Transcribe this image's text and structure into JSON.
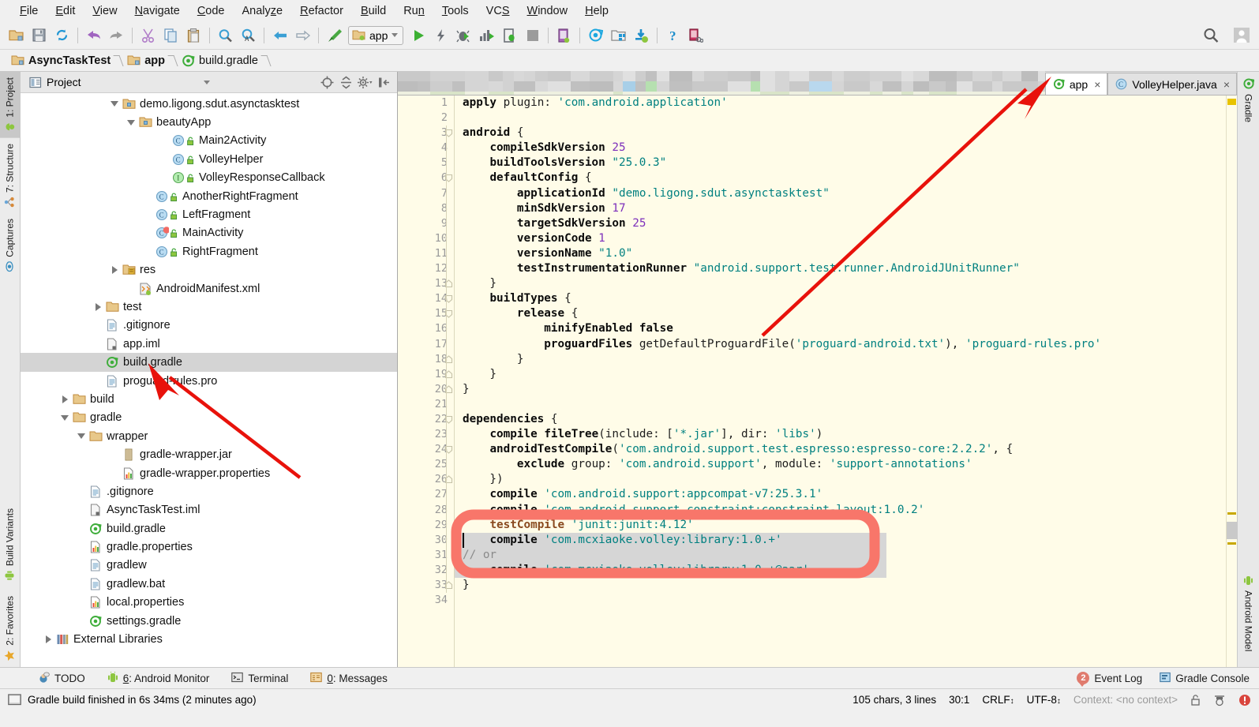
{
  "window": {
    "menus": [
      {
        "label": "File",
        "mnemonic": "F"
      },
      {
        "label": "Edit",
        "mnemonic": "E"
      },
      {
        "label": "View",
        "mnemonic": "V"
      },
      {
        "label": "Navigate",
        "mnemonic": "N"
      },
      {
        "label": "Code",
        "mnemonic": "C"
      },
      {
        "label": "Analyze",
        "mnemonic": "z"
      },
      {
        "label": "Refactor",
        "mnemonic": "R"
      },
      {
        "label": "Build",
        "mnemonic": "B"
      },
      {
        "label": "Run",
        "mnemonic": "n"
      },
      {
        "label": "Tools",
        "mnemonic": "T"
      },
      {
        "label": "VCS",
        "mnemonic": "S"
      },
      {
        "label": "Window",
        "mnemonic": "W"
      },
      {
        "label": "Help",
        "mnemonic": "H"
      }
    ]
  },
  "toolbar": {
    "icons": [
      "open-folder-icon",
      "save-all-icon",
      "sync-icon",
      "undo-icon",
      "redo-icon",
      "cut-icon",
      "copy-icon",
      "paste-icon",
      "find-icon",
      "replace-icon",
      "back-icon",
      "forward-icon",
      "make-project-icon"
    ],
    "run_config": "app",
    "run_icons": [
      "run-icon",
      "apply-changes-icon",
      "debug-icon",
      "run-with-coverage-icon",
      "attach-debugger-icon",
      "stop-icon",
      "avd-manager-icon",
      "sync-gradle-icon",
      "sdk-manager-icon",
      "download-icon",
      "help-icon",
      "device-monitor-icon"
    ],
    "search_icon": "search-everywhere-icon",
    "account_icon": "user-account-icon"
  },
  "breadcrumb": [
    {
      "label": "AsyncTaskTest",
      "icon": "module-folder-icon"
    },
    {
      "label": "app",
      "icon": "module-folder-icon"
    },
    {
      "label": "build.gradle",
      "icon": "gradle-file-icon"
    }
  ],
  "left_tool_buttons": [
    {
      "label": "1: Project",
      "icon": "android-icon",
      "active": true
    },
    {
      "label": "7: Structure",
      "icon": "structure-icon",
      "active": false
    },
    {
      "label": "Captures",
      "icon": "captures-icon",
      "active": false
    },
    {
      "label": "Build Variants",
      "icon": "android-green-icon",
      "active": false
    },
    {
      "label": "2: Favorites",
      "icon": "star-icon",
      "active": false
    }
  ],
  "right_tool_buttons": [
    {
      "label": "Gradle",
      "icon": "gradle-icon"
    },
    {
      "label": "Android Model",
      "icon": "android-green-icon"
    }
  ],
  "project_panel": {
    "title": "Project",
    "title_icon": "project-view-icon",
    "tools": [
      "locate-icon",
      "collapse-all-icon",
      "settings-gear-icon",
      "hide-icon"
    ],
    "tree": [
      {
        "label": "demo.ligong.sdut.asynctasktest",
        "indent": 5,
        "arrow": "open",
        "icon": "package-folder-icon",
        "selected": false
      },
      {
        "label": "beautyApp",
        "indent": 6,
        "arrow": "open",
        "icon": "package-folder-icon",
        "selected": false
      },
      {
        "label": "Main2Activity",
        "indent": 8,
        "arrow": "none",
        "icon": "class-icon",
        "selected": false
      },
      {
        "label": "VolleyHelper",
        "indent": 8,
        "arrow": "none",
        "icon": "class-icon",
        "selected": false
      },
      {
        "label": "VolleyResponseCallback",
        "indent": 8,
        "arrow": "none",
        "icon": "interface-icon",
        "selected": false
      },
      {
        "label": "AnotherRightFragment",
        "indent": 7,
        "arrow": "none",
        "icon": "class-icon",
        "selected": false
      },
      {
        "label": "LeftFragment",
        "indent": 7,
        "arrow": "none",
        "icon": "class-icon",
        "selected": false
      },
      {
        "label": "MainActivity",
        "indent": 7,
        "arrow": "none",
        "icon": "class-run-icon",
        "selected": false
      },
      {
        "label": "RightFragment",
        "indent": 7,
        "arrow": "none",
        "icon": "class-icon",
        "selected": false
      },
      {
        "label": "res",
        "indent": 5,
        "arrow": "closed",
        "icon": "res-folder-icon",
        "selected": false
      },
      {
        "label": "AndroidManifest.xml",
        "indent": 6,
        "arrow": "none",
        "icon": "manifest-icon",
        "selected": false
      },
      {
        "label": "test",
        "indent": 4,
        "arrow": "closed",
        "icon": "folder-icon",
        "selected": false
      },
      {
        "label": ".gitignore",
        "indent": 4,
        "arrow": "none",
        "icon": "text-file-icon",
        "selected": false
      },
      {
        "label": "app.iml",
        "indent": 4,
        "arrow": "none",
        "icon": "iml-file-icon",
        "selected": false
      },
      {
        "label": "build.gradle",
        "indent": 4,
        "arrow": "none",
        "icon": "gradle-file-icon",
        "selected": true
      },
      {
        "label": "proguard-rules.pro",
        "indent": 4,
        "arrow": "none",
        "icon": "text-file-icon",
        "selected": false
      },
      {
        "label": "build",
        "indent": 2,
        "arrow": "closed",
        "icon": "folder-icon",
        "selected": false
      },
      {
        "label": "gradle",
        "indent": 2,
        "arrow": "open",
        "icon": "folder-icon",
        "selected": false
      },
      {
        "label": "wrapper",
        "indent": 3,
        "arrow": "open",
        "icon": "folder-icon",
        "selected": false
      },
      {
        "label": "gradle-wrapper.jar",
        "indent": 5,
        "arrow": "none",
        "icon": "jar-file-icon",
        "selected": false
      },
      {
        "label": "gradle-wrapper.properties",
        "indent": 5,
        "arrow": "none",
        "icon": "properties-file-icon",
        "selected": false
      },
      {
        "label": ".gitignore",
        "indent": 3,
        "arrow": "none",
        "icon": "text-file-icon",
        "selected": false
      },
      {
        "label": "AsyncTaskTest.iml",
        "indent": 3,
        "arrow": "none",
        "icon": "iml-file-icon",
        "selected": false
      },
      {
        "label": "build.gradle",
        "indent": 3,
        "arrow": "none",
        "icon": "gradle-file-icon",
        "selected": false
      },
      {
        "label": "gradle.properties",
        "indent": 3,
        "arrow": "none",
        "icon": "properties-file-icon",
        "selected": false
      },
      {
        "label": "gradlew",
        "indent": 3,
        "arrow": "none",
        "icon": "text-file-icon",
        "selected": false
      },
      {
        "label": "gradlew.bat",
        "indent": 3,
        "arrow": "none",
        "icon": "text-file-icon",
        "selected": false
      },
      {
        "label": "local.properties",
        "indent": 3,
        "arrow": "none",
        "icon": "properties-file-icon",
        "selected": false
      },
      {
        "label": "settings.gradle",
        "indent": 3,
        "arrow": "none",
        "icon": "gradle-file-icon",
        "selected": false
      },
      {
        "label": "External Libraries",
        "indent": 1,
        "arrow": "closed",
        "icon": "libraries-icon",
        "selected": false
      }
    ]
  },
  "editor": {
    "tabs": [
      {
        "label": "app",
        "icon": "gradle-file-icon",
        "active": true,
        "close": "×"
      },
      {
        "label": "VolleyHelper.java",
        "icon": "class-icon",
        "active": false,
        "close": "×"
      }
    ],
    "first_line": 1,
    "last_line": 34,
    "highlighted_lines": [
      30,
      31,
      32
    ],
    "code_lines": [
      "apply plugin: 'com.android.application'",
      "",
      "android {",
      "    compileSdkVersion 25",
      "    buildToolsVersion \"25.0.3\"",
      "    defaultConfig {",
      "        applicationId \"demo.ligong.sdut.asynctasktest\"",
      "        minSdkVersion 17",
      "        targetSdkVersion 25",
      "        versionCode 1",
      "        versionName \"1.0\"",
      "        testInstrumentationRunner \"android.support.test.runner.AndroidJUnitRunner\"",
      "    }",
      "    buildTypes {",
      "        release {",
      "            minifyEnabled false",
      "            proguardFiles getDefaultProguardFile('proguard-android.txt'), 'proguard-rules.pro'",
      "        }",
      "    }",
      "}",
      "",
      "dependencies {",
      "    compile fileTree(include: ['*.jar'], dir: 'libs')",
      "    androidTestCompile('com.android.support.test.espresso:espresso-core:2.2.2', {",
      "        exclude group: 'com.android.support', module: 'support-annotations'",
      "    })",
      "    compile 'com.android.support:appcompat-v7:25.3.1'",
      "    compile 'com.android.support.constraint:constraint-layout:1.0.2'",
      "    testCompile 'junit:junit:4.12'",
      "    compile 'com.mcxiaoke.volley:library:1.0.+'",
      "// or",
      "    compile 'com.mcxiaoke.volley:library:1.0.+@aar'",
      "}",
      ""
    ]
  },
  "bottom_tool_buttons": [
    {
      "label": "TODO",
      "icon": "todo-icon"
    },
    {
      "label": "6: Android Monitor",
      "icon": "android-green-icon"
    },
    {
      "label": "Terminal",
      "icon": "terminal-icon"
    },
    {
      "label": "0: Messages",
      "icon": "messages-icon"
    }
  ],
  "bottom_right_buttons": [
    {
      "label": "Event Log",
      "icon": "event-log-icon",
      "badge": "2"
    },
    {
      "label": "Gradle Console",
      "icon": "gradle-console-icon",
      "badge": ""
    }
  ],
  "statusbar": {
    "icon": "status-window-icon",
    "message": "Gradle build finished in 6s 34ms (2 minutes ago)",
    "chars": "105 chars, 3 lines",
    "caret": "30:1",
    "line_sep": "CRLF",
    "encoding": "UTF-8",
    "context": "Context: <no context>",
    "right_icons": [
      "lock-icon",
      "inspector-icon",
      "error-icon"
    ]
  },
  "colors": {
    "editor_bg": "#fffce8",
    "selection_bg": "#d6d6d6",
    "annotation_red": "#f8766a",
    "arrow_red": "#e8120b",
    "string": "#008080",
    "number": "#7d2fbb",
    "test_compile": "#8a4a1f"
  }
}
